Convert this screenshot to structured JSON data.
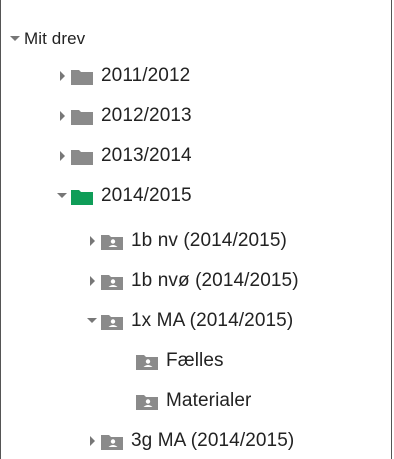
{
  "colors": {
    "folder_gray": "#8a8a8a",
    "folder_green": "#0f9d58",
    "shared_folder": "#8a8a8a",
    "toggle": "#777777"
  },
  "tree": {
    "root": {
      "label": "Mit drev",
      "state": "expanded"
    },
    "items": [
      {
        "label": "2011/2012",
        "state": "collapsed",
        "icon": "folder-icon"
      },
      {
        "label": "2012/2013",
        "state": "collapsed",
        "icon": "folder-icon"
      },
      {
        "label": "2013/2014",
        "state": "collapsed",
        "icon": "folder-icon"
      },
      {
        "label": "2014/2015",
        "state": "expanded",
        "icon": "green-folder-icon"
      },
      {
        "label": "1b nv (2014/2015)",
        "state": "collapsed",
        "icon": "shared-folder-icon"
      },
      {
        "label": "1b nvø (2014/2015)",
        "state": "collapsed",
        "icon": "shared-folder-icon"
      },
      {
        "label": "1x MA (2014/2015)",
        "state": "expanded",
        "icon": "shared-folder-icon"
      },
      {
        "label": "Fælles",
        "state": "none",
        "icon": "shared-folder-icon"
      },
      {
        "label": "Materialer",
        "state": "none",
        "icon": "shared-folder-icon"
      },
      {
        "label": "3g MA (2014/2015)",
        "state": "collapsed",
        "icon": "shared-folder-icon"
      }
    ]
  }
}
